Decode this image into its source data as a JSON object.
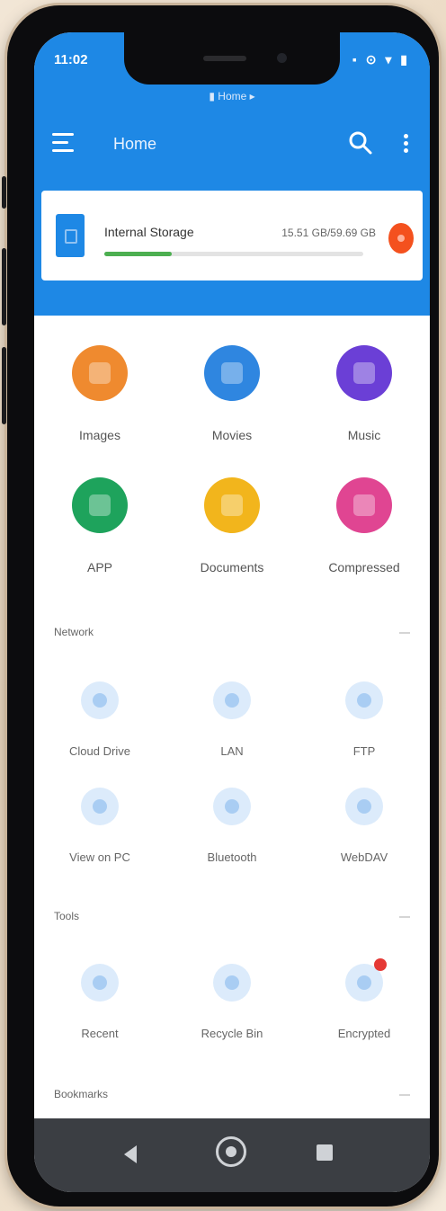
{
  "status_bar": {
    "time": "11:02",
    "icons_text": "▪ ⊙ ▾ ▮"
  },
  "path_bar": {
    "icon": "folder-icon",
    "text": "Home"
  },
  "toolbar": {
    "title": "Home"
  },
  "storage": {
    "label": "Internal Storage",
    "size": "15.51 GB/59.69 GB",
    "used_percent": 26,
    "bar_color": "#4caf50"
  },
  "categories": [
    {
      "label": "Images",
      "color": "#ef8a2f",
      "icon": "image-icon"
    },
    {
      "label": "Movies",
      "color": "#2f86e0",
      "icon": "movie-icon"
    },
    {
      "label": "Music",
      "color": "#6b3fd6",
      "icon": "headphones-icon"
    },
    {
      "label": "APP",
      "color": "#1ea35c",
      "icon": "android-icon"
    },
    {
      "label": "Documents",
      "color": "#f2b51c",
      "icon": "document-icon"
    },
    {
      "label": "Compressed",
      "color": "#e04592",
      "icon": "archive-icon"
    }
  ],
  "network": {
    "title": "Network",
    "items": [
      {
        "label": "Cloud Drive",
        "icon": "cloud-icon"
      },
      {
        "label": "LAN",
        "icon": "lan-icon"
      },
      {
        "label": "FTP",
        "icon": "ftp-icon"
      },
      {
        "label": "View on PC",
        "icon": "pc-icon"
      },
      {
        "label": "Bluetooth",
        "icon": "bluetooth-icon"
      },
      {
        "label": "WebDAV",
        "icon": "webdav-icon"
      }
    ]
  },
  "tools": {
    "title": "Tools",
    "items": [
      {
        "label": "Recent",
        "icon": "clock-icon"
      },
      {
        "label": "Recycle Bin",
        "icon": "trash-icon"
      },
      {
        "label": "Encrypted",
        "icon": "lock-icon"
      }
    ]
  },
  "bookmarks": {
    "title": "Bookmarks"
  },
  "colors": {
    "primary": "#1e88e5",
    "nav_bar": "#3b3e43",
    "badge": "#e53935"
  }
}
